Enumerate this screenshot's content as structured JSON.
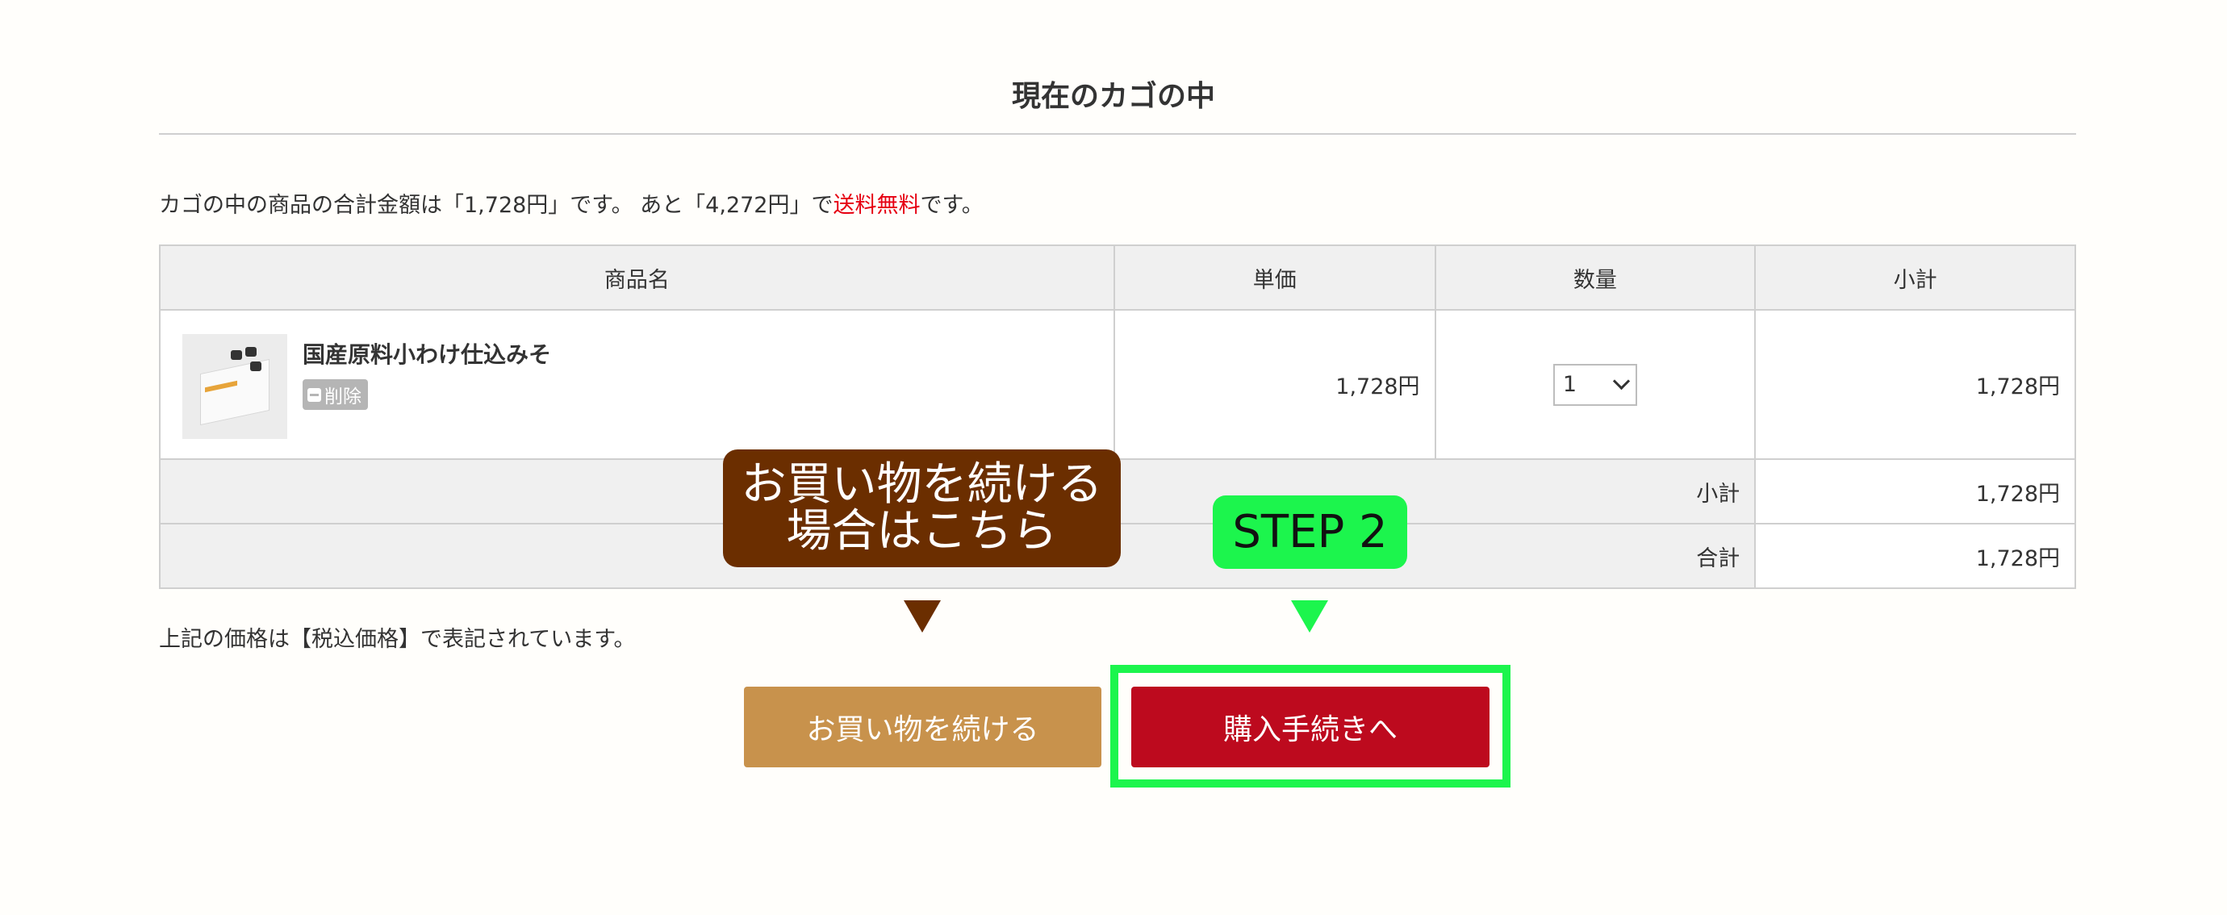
{
  "page": {
    "title": "現在のカゴの中"
  },
  "summary": {
    "prefix": "カゴの中の商品の合計金額は「1,728円」です。 あと「4,272円」で",
    "highlight": "送料無料",
    "suffix": "です。",
    "highlight_color": "#e60012"
  },
  "table": {
    "headers": {
      "name": "商品名",
      "unit_price": "単価",
      "quantity": "数量",
      "subtotal": "小計"
    },
    "item": {
      "name": "国産原料小わけ仕込みそ",
      "delete_label": "削除",
      "unit_price": "1,728円",
      "quantity": "1",
      "subtotal": "1,728円"
    },
    "subtotal_label": "小計",
    "subtotal_value": "1,728円",
    "total_label": "合計",
    "total_value": "1,728円"
  },
  "tax_note": "上記の価格は【税込価格】で表記されています。",
  "callouts": {
    "continue_line1": "お買い物を続ける",
    "continue_line2": "場合はこちら",
    "step": "STEP 2",
    "brown_color": "#6b2e00",
    "green_color": "#1cf54d"
  },
  "buttons": {
    "continue_label": "お買い物を続ける",
    "checkout_label": "購入手続きへ",
    "continue_color": "#c8924c",
    "checkout_color": "#bd0a1e"
  }
}
